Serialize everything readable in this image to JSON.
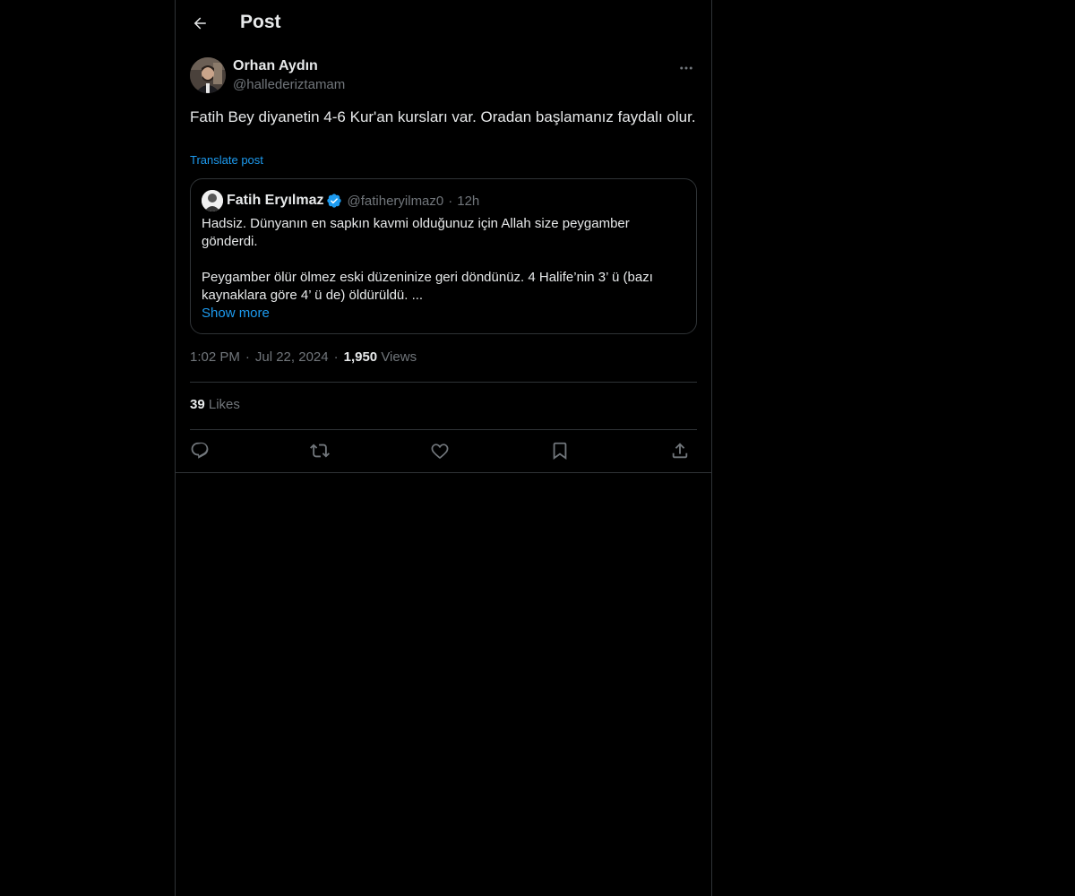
{
  "header": {
    "title": "Post",
    "back_icon": "arrow-left-icon"
  },
  "post": {
    "author_name": "Orhan Aydın",
    "author_handle": "@hallederiztamam",
    "text": "Fatih Bey diyanetin 4-6 Kur'an kursları var. Oradan başlamanız faydalı olur.",
    "translate_label": "Translate post",
    "time": "1:02 PM",
    "date": "Jul 22, 2024",
    "views_count": "1,950",
    "views_label": "Views",
    "likes_count": "39",
    "likes_label": "Likes"
  },
  "quote": {
    "name": "Fatih Eryılmaz",
    "handle": "@fatiheryilmaz0",
    "time": "12h",
    "verified": true,
    "paragraph1": "Hadsiz. Dünyanın en sapkın kavmi olduğunuz için Allah size peygamber gönderdi.",
    "paragraph2": "Peygamber ölür ölmez eski düzeninize geri döndünüz. 4 Halife’nin 3’ ü (bazı kaynaklara göre 4’ ü de) öldürüldü. ...",
    "show_more": "Show more"
  },
  "actions": [
    "reply-icon",
    "repost-icon",
    "like-icon",
    "bookmark-icon",
    "share-icon"
  ],
  "colors": {
    "background": "#000000",
    "text": "#e7e9ea",
    "secondary": "#71767b",
    "accent": "#1d9bf0",
    "border": "#2f3336"
  }
}
